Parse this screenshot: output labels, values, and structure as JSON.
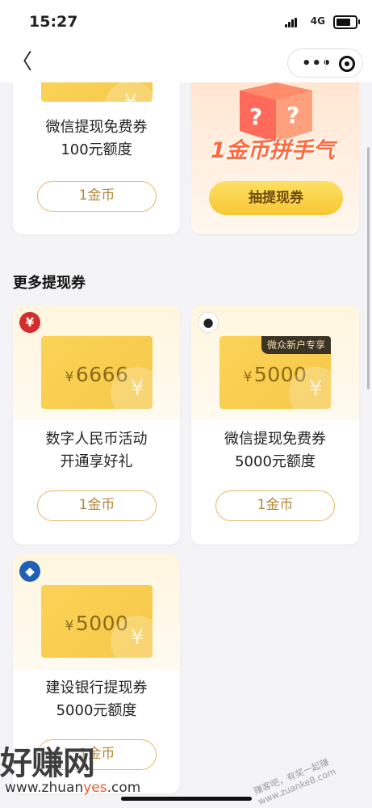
{
  "status": {
    "time": "15:27",
    "network": "4G"
  },
  "nav": {
    "back_glyph": "〈",
    "more_glyph": "•••"
  },
  "top_left": {
    "title_line1": "微信提现免费券",
    "title_line2": "100元额度",
    "button": "1金币"
  },
  "top_right": {
    "promo": "1金币拼手气",
    "button": "抽提现券"
  },
  "section_title": "更多提现券",
  "cards": [
    {
      "logo": "¥",
      "amount": "6666",
      "currency": "¥",
      "title_line1": "数字人民币活动",
      "title_line2": "开通享好礼",
      "button": "1金币"
    },
    {
      "logo": "●",
      "tag": "微众新户专享",
      "amount": "5000",
      "currency": "¥",
      "title_line1": "微信提现免费券",
      "title_line2": "5000元额度",
      "button": "1金币"
    },
    {
      "logo": "◆",
      "amount": "5000",
      "currency": "¥",
      "title_line1": "建设银行提现券",
      "title_line2": "5000元额度",
      "button": "1金币"
    }
  ],
  "watermark": {
    "line1": "好赚网",
    "line2_a": "www.zhuan",
    "line2_b": "yes",
    "line2_c": ".com",
    "corner": "赚客吧，有奖一起赚 www.zuanke8.com"
  },
  "colors": {
    "accent": "#f8c634",
    "coupon": "#fbd356",
    "button_border": "#e3b766"
  }
}
